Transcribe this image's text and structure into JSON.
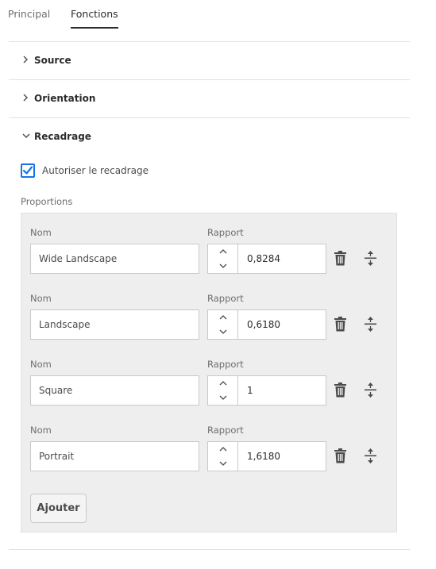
{
  "tabs": [
    {
      "label": "Principal",
      "active": false
    },
    {
      "label": "Fonctions",
      "active": true
    }
  ],
  "sections": {
    "source": {
      "title": "Source",
      "expanded": false
    },
    "orientation": {
      "title": "Orientation",
      "expanded": false
    },
    "recadrage": {
      "title": "Recadrage",
      "expanded": true
    }
  },
  "recadrage": {
    "allow_crop_label": "Autoriser le recadrage",
    "allow_crop_checked": true,
    "proportions_label": "Proportions",
    "name_label": "Nom",
    "ratio_label": "Rapport",
    "rows": [
      {
        "name": "Wide Landscape",
        "ratio": "0,8284"
      },
      {
        "name": "Landscape",
        "ratio": "0,6180"
      },
      {
        "name": "Square",
        "ratio": "1"
      },
      {
        "name": "Portrait",
        "ratio": "1,6180"
      }
    ],
    "add_label": "Ajouter"
  },
  "icons": {
    "chevron_collapsed": "chevron-right-icon",
    "chevron_expanded": "chevron-down-icon",
    "delete": "trash-icon",
    "reorder": "drag-handle-icon",
    "increment": "chevron-up-icon",
    "decrement": "chevron-down-icon"
  },
  "colors": {
    "accent": "#1473e6",
    "panel_bg": "#eeeeee"
  }
}
